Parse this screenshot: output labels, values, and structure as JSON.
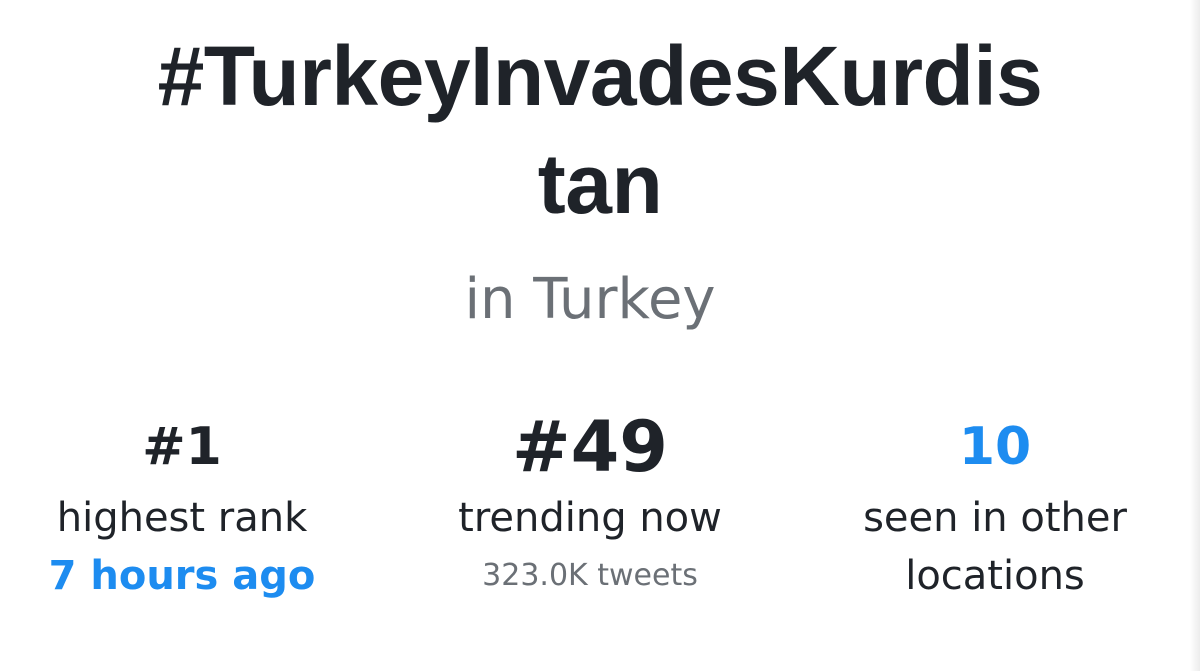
{
  "trend": {
    "hashtag_line1": "#TurkeyInvadesKurdis",
    "hashtag_line2": "tan",
    "location": "in Turkey"
  },
  "stats": {
    "highest_rank": {
      "value": "#1",
      "label": "highest rank",
      "time": "7 hours ago"
    },
    "trending_now": {
      "value": "#49",
      "label": "trending now",
      "tweets": "323.0K tweets"
    },
    "other_locations": {
      "value": "10",
      "label_line1": "seen in other",
      "label_line2": "locations"
    }
  },
  "colors": {
    "text": "#1f2329",
    "muted": "#6b7076",
    "accent": "#1d8cf0",
    "background": "#ffffff"
  }
}
